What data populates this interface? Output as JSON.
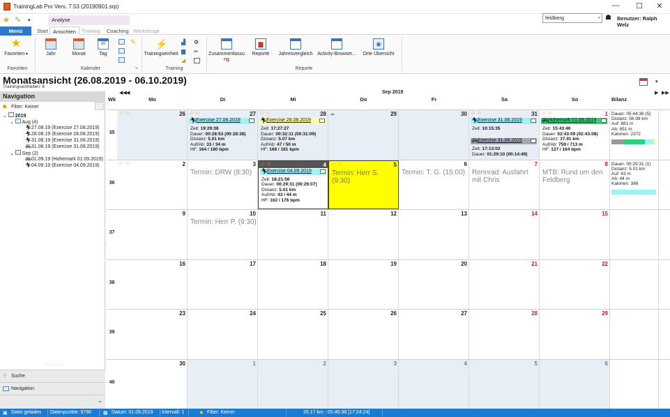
{
  "window": {
    "title": "TrainingLab Pro Vers. 7.53 (20190901.srp)",
    "min": "—",
    "max": "☐",
    "close": "✕"
  },
  "qat": {
    "context_tab": "Analyse",
    "search_value": "feldberg",
    "user_label": "Benutzer: Ralph Welz"
  },
  "tabs": {
    "menu": "Menü",
    "items": [
      "Start",
      "Ansichten",
      "Training",
      "Coaching",
      "Werkzeuge"
    ]
  },
  "ribbon": {
    "favoriten": "Favoriten",
    "jahr": "Jahr",
    "monat": "Monat",
    "tag": "Tag",
    "trainingseinheit": "Trainingseinheit",
    "zusammenfassung": "Zusammenfassu\nng",
    "reporte": "Reporte",
    "jahresvergleich": "Jahresvergleich",
    "activity_browser": "Activity-Browser...",
    "orte": "Orte Übersicht",
    "groups": {
      "favoriten": "Favoriten",
      "kalender": "Kalender",
      "training": "Training",
      "reporte": "Reporte"
    }
  },
  "page": {
    "title": "Monatsansicht (26.08.2019 - 06.10.2019)",
    "subtitle": "Trainingseinheiten: 6"
  },
  "nav": {
    "header": "Navigation",
    "filter": "Filter: Keiner",
    "year": "2019",
    "aug": "Aug (4)",
    "aug_items": [
      "27.08.19 (Exercise 27.08.2019)",
      "28.08.19 (Exercise 28.08.2019)",
      "31.08.19 (Exercise 31.08.2019)",
      "31.08.19 (Exercise 31.08.2019)"
    ],
    "sep": "Sep (2)",
    "sep_items": [
      "01.09.19 (Hohemark 01.09.2019)",
      "04.09.19 (Exercise 04.09.2019)"
    ],
    "suche": "Suche",
    "navigation": "Navigation"
  },
  "calendar": {
    "month": "Sep 2019",
    "headers": [
      "Wk",
      "Mo",
      "Di",
      "Mi",
      "Do",
      "Fr",
      "Sa",
      "So",
      "Bilanz"
    ],
    "weeks": [
      "35",
      "36",
      "37",
      "38",
      "39",
      "40"
    ],
    "days": [
      [
        "26",
        "27",
        "28",
        "29",
        "30",
        "31",
        "1"
      ],
      [
        "2",
        "3",
        "4",
        "5",
        "6",
        "7",
        "8"
      ],
      [
        "9",
        "10",
        "11",
        "12",
        "13",
        "14",
        "15"
      ],
      [
        "16",
        "17",
        "18",
        "19",
        "20",
        "21",
        "22"
      ],
      [
        "23",
        "24",
        "25",
        "26",
        "27",
        "28",
        "29"
      ],
      [
        "30",
        "1",
        "2",
        "3",
        "4",
        "5",
        "6"
      ]
    ],
    "exercises": {
      "e27": {
        "name": "Exercise 27.08.2019",
        "zeit": "Zeit: ",
        "zeit_v": "19:29:38",
        "dauer": "Dauer: ",
        "dauer_v": "00:28:53  (00:28:38)",
        "dist": "Distanz: ",
        "dist_v": "5.01 km",
        "auf": "Auf/Ab: ",
        "auf_v": "33 / 34 m",
        "hf": "HF: ",
        "hf_v": "164 / 180 bpm"
      },
      "e28": {
        "name": "Exercise 28.08.2019",
        "zeit": "Zeit: ",
        "zeit_v": "17:27:27",
        "dauer": "Dauer: ",
        "dauer_v": "00:32:11  (00:31:09)",
        "dist": "Distanz: ",
        "dist_v": "5.07 km",
        "auf": "Auf/Ab: ",
        "auf_v": "47 / 50 m",
        "hf": "HF: ",
        "hf_v": "168 / 181 bpm"
      },
      "e31a": {
        "name": "Exercise 31.08.2019",
        "zeit": "Zeit: ",
        "zeit_v": "10:15:35"
      },
      "e31b": {
        "name": "Exercise 31.08.2019",
        "zeit": "Zeit: ",
        "zeit_v": "17:13:02",
        "dauer": "Dauer: ",
        "dauer_v": "01:29:10  (00:14:49)"
      },
      "e01": {
        "name": "Hohemark 01.09.2019",
        "zeit": "Zeit: ",
        "zeit_v": "15:43:46",
        "dauer": "Dauer: ",
        "dauer_v": "02:43:09  (02:43:08)",
        "dist": "Distanz: ",
        "dist_v": "37.91 km",
        "auf": "Auf/Ab: ",
        "auf_v": "759 / 713 m",
        "hf": "HF: ",
        "hf_v": "127 / 164 bpm"
      },
      "e04": {
        "name": "Exercise 04.09.2019",
        "zeit": "Zeit: ",
        "zeit_v": "18:21:56",
        "dauer": "Dauer: ",
        "dauer_v": "00:29:31  (00:29:07)",
        "dist": "Distanz: ",
        "dist_v": "5.01 km",
        "auf": "Auf/Ab: ",
        "auf_v": "43 / 44 m",
        "hf": "HF: ",
        "hf_v": "162 / 176 bpm"
      }
    },
    "termine": {
      "drw": "Termin: DRW (8:30)",
      "herrs": "Termin: Herr S. (9:30)",
      "tg": "Termin: T. G. (15:00)",
      "rennrad": "Rennrad: Ausfahrt mit Chris",
      "mtb": "MTB: Rund um den Feldberg",
      "herrp": "Termin: Herr P. (9:30)"
    },
    "bilanz35": [
      "Dauer: 05:44:36 (5)",
      "Distanz: 56.99 km",
      "Auf: 881 m",
      "Ab: 851 m",
      "Kalorien: 2372"
    ],
    "bilanz36": [
      "Dauer: 00:29:31 (1)",
      "Distanz: 5.01 km",
      "Auf: 43 m",
      "Ab: 44 m",
      "Kalorien: 386"
    ]
  },
  "status": {
    "geladen": "Datei geladen",
    "punkte": "Datenpunkte: 9790",
    "datum": "Datum: 01.09.2019",
    "intervall": "Intervall: 1",
    "filter": "Filter: Keiner",
    "summary": "20.17 km - 01:40:38 [17:24:24]"
  },
  "colors": {
    "accent": "#2f78c4",
    "today": "#ffff00",
    "exercise_cyan": "#9ff3f3",
    "exercise_yellow": "#ffff9a",
    "exercise_gray": "#a8a8a8",
    "exercise_green": "#2dd07a"
  }
}
